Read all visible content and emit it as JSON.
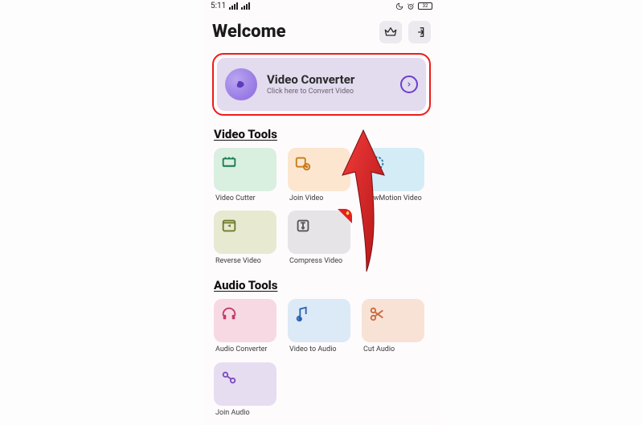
{
  "statusbar": {
    "time": "5:11",
    "battery": "32"
  },
  "header": {
    "title": "Welcome"
  },
  "hero": {
    "title": "Video Converter",
    "subtitle": "Click here to Convert Video"
  },
  "sections": {
    "video": {
      "heading": "Video Tools",
      "tools": [
        {
          "label": "Video Cutter"
        },
        {
          "label": "Join Video"
        },
        {
          "label": "SlowMotion Video"
        },
        {
          "label": "Reverse Video"
        },
        {
          "label": "Compress Video"
        }
      ]
    },
    "audio": {
      "heading": "Audio Tools",
      "tools": [
        {
          "label": "Audio Converter"
        },
        {
          "label": "Video to Audio"
        },
        {
          "label": "Cut Audio"
        },
        {
          "label": "Join Audio"
        }
      ]
    }
  }
}
